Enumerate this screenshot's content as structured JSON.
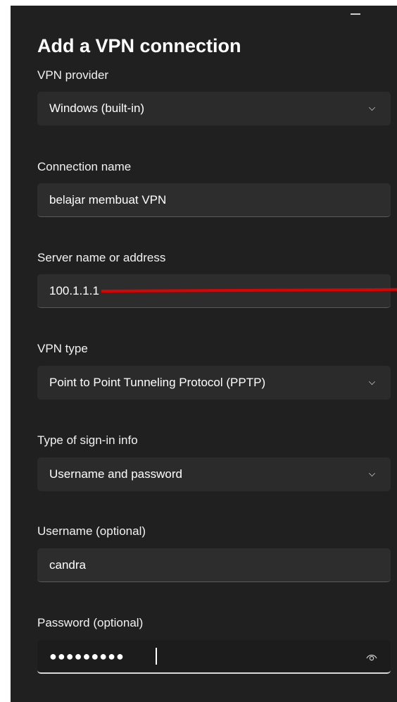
{
  "dialog": {
    "title": "Add a VPN connection"
  },
  "fields": {
    "vpn_provider": {
      "label": "VPN provider",
      "value": "Windows (built-in)"
    },
    "connection_name": {
      "label": "Connection name",
      "value": "belajar membuat VPN"
    },
    "server": {
      "label": "Server name or address",
      "value": "100.1.1.1"
    },
    "vpn_type": {
      "label": "VPN type",
      "value": "Point to Point Tunneling Protocol (PPTP)"
    },
    "sign_in_type": {
      "label": "Type of sign-in info",
      "value": "Username and password"
    },
    "username": {
      "label": "Username (optional)",
      "value": "candra"
    },
    "password": {
      "label": "Password (optional)",
      "masked_value": "●●●●●●●●●"
    }
  },
  "icons": {
    "minimize": "minimize-icon",
    "dropdown": "chevron-down-icon",
    "reveal_password": "eye-icon"
  },
  "colors": {
    "dialog_bg": "#202020",
    "field_bg": "#2d2d2d",
    "annotation": "#e00000"
  }
}
